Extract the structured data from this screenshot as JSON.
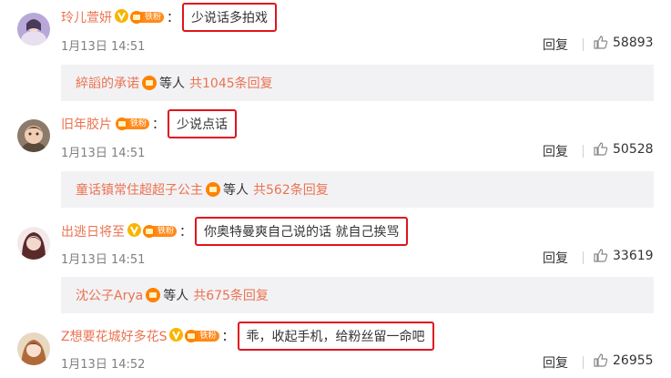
{
  "colors": {
    "username": "#eb7350",
    "highlight_border": "#e0141e",
    "subreply_bg": "#f2f2f5",
    "fan_badge": "#ff8a1a",
    "verified": "#f8b500"
  },
  "icons": {
    "verified": "v-badge-icon",
    "fan": "iron-fan-badge-icon",
    "like": "thumbs-up-icon"
  },
  "fan_label": "铁粉",
  "colon": "：",
  "comments": [
    {
      "username": "玲儿萱妍",
      "verified": true,
      "text": "少说话多拍戏",
      "date": "1月13日 14:51",
      "reply_label": "回复",
      "likes": "58893",
      "subreply": {
        "name": "綷謟的承诺",
        "suffix": "等人",
        "total": "共1045条回复"
      }
    },
    {
      "username": "旧年胶片",
      "verified": false,
      "text": "少说点话",
      "date": "1月13日 14:51",
      "reply_label": "回复",
      "likes": "50528",
      "subreply": {
        "name": "童话镇常住超超子公主",
        "suffix": "等人",
        "total": "共562条回复"
      }
    },
    {
      "username": "出逃日将至",
      "verified": true,
      "text": "你奥特曼爽自己说的话 就自己挨骂",
      "date": "1月13日 14:51",
      "reply_label": "回复",
      "likes": "33619",
      "subreply": {
        "name": "沈公子Arya",
        "suffix": "等人",
        "total": "共675条回复"
      }
    },
    {
      "username": "Z想要花城好多花S",
      "verified": true,
      "text": "乖，收起手机，给粉丝留一命吧",
      "date": "1月13日 14:52",
      "reply_label": "回复",
      "likes": "26955"
    }
  ]
}
